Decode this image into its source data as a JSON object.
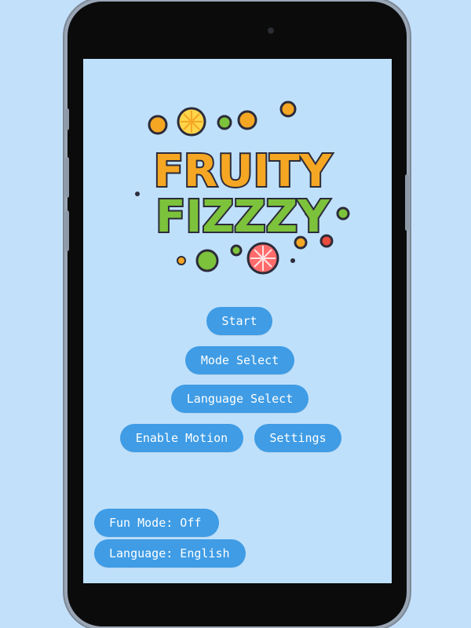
{
  "logo": {
    "line1": "FRUITY",
    "line2": "FIZZZY"
  },
  "menu": {
    "start_label": "Start",
    "mode_select_label": "Mode Select",
    "language_select_label": "Language Select",
    "enable_motion_label": "Enable Motion",
    "settings_label": "Settings"
  },
  "status": {
    "fun_mode_label": "Fun Mode: Off",
    "language_label": "Language: English"
  },
  "colors": {
    "background": "#c3e0fb",
    "button": "#3f9ce5",
    "button_text": "#ffffff",
    "logo_orange": "#f5a623",
    "logo_green": "#7cc23b",
    "logo_red": "#e94b3c"
  }
}
